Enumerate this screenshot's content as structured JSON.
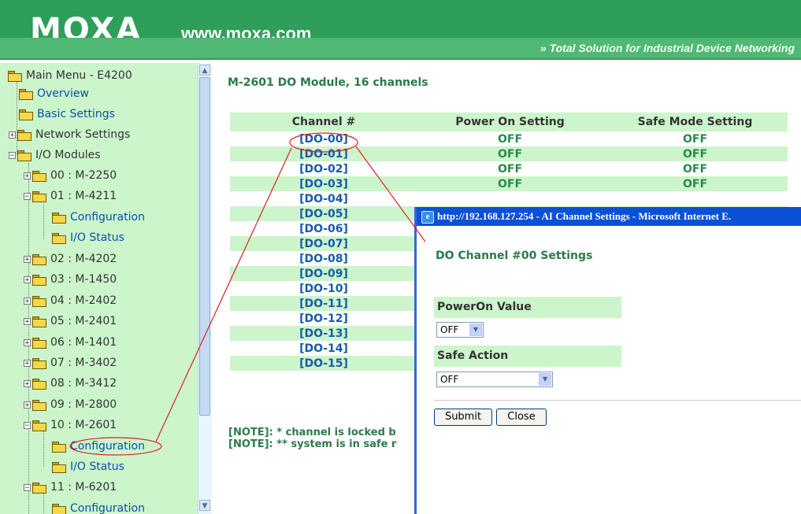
{
  "header": {
    "logo": "MOXA",
    "site": "www.moxa.com",
    "tagline": "» Total Solution for Industrial Device Networking"
  },
  "sidebar": {
    "root": "Main Menu - E4200",
    "overview": "Overview",
    "basic_settings": "Basic Settings",
    "network_settings": "Network Settings",
    "io_modules": "I/O Modules",
    "modules": [
      {
        "label": "00 : M-2250"
      },
      {
        "label": "01 : M-4211",
        "children": [
          "Configuration",
          "I/O Status"
        ]
      },
      {
        "label": "02 : M-4202"
      },
      {
        "label": "03 : M-1450"
      },
      {
        "label": "04 : M-2402"
      },
      {
        "label": "05 : M-2401"
      },
      {
        "label": "06 : M-1401"
      },
      {
        "label": "07 : M-3402"
      },
      {
        "label": "08 : M-3412"
      },
      {
        "label": "09 : M-2800"
      },
      {
        "label": "10 : M-2601",
        "children": [
          "Configuration",
          "I/O Status"
        ]
      },
      {
        "label": "11 : M-6201",
        "children": [
          "Configuration"
        ]
      }
    ]
  },
  "main": {
    "title": "M-2601 DO Module, 16 channels",
    "columns": [
      "Channel #",
      "Power On Setting",
      "Safe Mode Setting"
    ],
    "rows": [
      {
        "channel": "[DO-00]",
        "power_on": "OFF",
        "safe_mode": "OFF"
      },
      {
        "channel": "[DO-01]",
        "power_on": "OFF",
        "safe_mode": "OFF"
      },
      {
        "channel": "[DO-02]",
        "power_on": "OFF",
        "safe_mode": "OFF"
      },
      {
        "channel": "[DO-03]",
        "power_on": "OFF",
        "safe_mode": "OFF"
      },
      {
        "channel": "[DO-04]",
        "power_on": "",
        "safe_mode": ""
      },
      {
        "channel": "[DO-05]",
        "power_on": "",
        "safe_mode": ""
      },
      {
        "channel": "[DO-06]",
        "power_on": "",
        "safe_mode": ""
      },
      {
        "channel": "[DO-07]",
        "power_on": "",
        "safe_mode": ""
      },
      {
        "channel": "[DO-08]",
        "power_on": "",
        "safe_mode": ""
      },
      {
        "channel": "[DO-09]",
        "power_on": "",
        "safe_mode": ""
      },
      {
        "channel": "[DO-10]",
        "power_on": "",
        "safe_mode": ""
      },
      {
        "channel": "[DO-11]",
        "power_on": "",
        "safe_mode": ""
      },
      {
        "channel": "[DO-12]",
        "power_on": "",
        "safe_mode": ""
      },
      {
        "channel": "[DO-13]",
        "power_on": "",
        "safe_mode": ""
      },
      {
        "channel": "[DO-14]",
        "power_on": "",
        "safe_mode": ""
      },
      {
        "channel": "[DO-15]",
        "power_on": "",
        "safe_mode": ""
      }
    ],
    "note1": "[NOTE]: * channel is locked b",
    "note2": "[NOTE]: ** system is in safe r"
  },
  "popup": {
    "titlebar": "http://192.168.127.254 - AI Channel Settings - Microsoft Internet E.",
    "title": "DO Channel #00 Settings",
    "poweron_label": "PowerOn Value",
    "poweron_value": "OFF",
    "safe_label": "Safe Action",
    "safe_value": "OFF",
    "submit": "Submit",
    "close": "Close"
  },
  "colors": {
    "header_green": "#2f9e5a",
    "sidebar_bg": "#ccf5cc",
    "link_blue": "#1a5aa8",
    "text_green": "#2a8a4a",
    "annotation_red": "#e02020",
    "titlebar_blue": "#0a50d8"
  }
}
